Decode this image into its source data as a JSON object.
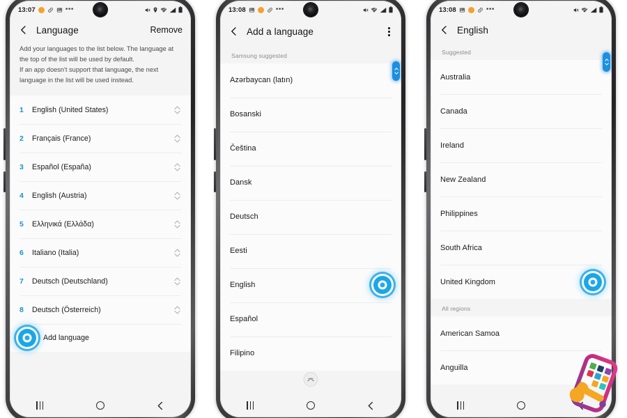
{
  "panels": [
    {
      "id": "language-settings",
      "statusbar": {
        "time": "13:07",
        "left_icons": [
          "badge-icon",
          "link-icon",
          "image-icon",
          "more-icon"
        ],
        "right_icons": [
          "mute-icon",
          "location-icon",
          "wifi-icon",
          "signal-icon",
          "battery-icon"
        ]
      },
      "appbar": {
        "back": "back-icon",
        "title": "Language",
        "action": "Remove"
      },
      "description": [
        "Add your languages to the list below. The language at the top of the list will be used by default.",
        "If an app doesn't support that language, the next language in the list will be used instead."
      ],
      "languages": [
        {
          "num": "1",
          "label": "English (United States)"
        },
        {
          "num": "2",
          "label": "Français (France)"
        },
        {
          "num": "3",
          "label": "Español (España)"
        },
        {
          "num": "4",
          "label": "English (Austria)"
        },
        {
          "num": "5",
          "label": "Ελληνικά (Ελλάδα)"
        },
        {
          "num": "6",
          "label": "Italiano (Italia)"
        },
        {
          "num": "7",
          "label": "Deutsch (Deutschland)"
        },
        {
          "num": "8",
          "label": "Deutsch (Österreich)"
        }
      ],
      "add_language": "Add language",
      "navbar": [
        "recents-icon",
        "home-icon",
        "back-icon"
      ]
    },
    {
      "id": "add-a-language",
      "statusbar": {
        "time": "13:08",
        "left_icons": [
          "image-icon",
          "badge-icon",
          "link-icon",
          "more-icon"
        ],
        "right_icons": [
          "mute-icon",
          "wifi-icon",
          "signal-icon",
          "battery-icon"
        ]
      },
      "appbar": {
        "back": "back-icon",
        "title": "Add a language",
        "action": "kebab-menu-icon"
      },
      "section_header": "Samsung suggested",
      "items": [
        {
          "label": "Azərbaycan (latın)",
          "selected": false
        },
        {
          "label": "Bosanski",
          "selected": false
        },
        {
          "label": "Čeština",
          "selected": false
        },
        {
          "label": "Dansk",
          "selected": false
        },
        {
          "label": "Deutsch",
          "selected": false
        },
        {
          "label": "Eesti",
          "selected": false
        },
        {
          "label": "English",
          "selected": true
        },
        {
          "label": "Español",
          "selected": false
        },
        {
          "label": "Filipino",
          "selected": false
        }
      ],
      "collapse_button": "collapse-up-icon",
      "navbar": [
        "recents-icon",
        "home-icon",
        "back-icon"
      ]
    },
    {
      "id": "english-regions",
      "statusbar": {
        "time": "13:08",
        "left_icons": [
          "image-icon",
          "badge-icon",
          "link-icon",
          "more-icon"
        ],
        "right_icons": [
          "mute-icon",
          "wifi-icon",
          "signal-icon",
          "battery-icon"
        ]
      },
      "appbar": {
        "back": "back-icon",
        "title": "English",
        "action": ""
      },
      "section_header": "Suggested",
      "items": [
        {
          "label": "Australia",
          "selected": false
        },
        {
          "label": "Canada",
          "selected": false
        },
        {
          "label": "Ireland",
          "selected": false
        },
        {
          "label": "New Zealand",
          "selected": false
        },
        {
          "label": "Philippines",
          "selected": false
        },
        {
          "label": "South Africa",
          "selected": false
        },
        {
          "label": "United Kingdom",
          "selected": true
        }
      ],
      "section_header_2": "All regions",
      "items_2": [
        {
          "label": "American Samoa",
          "selected": false
        },
        {
          "label": "Anguilla",
          "selected": false
        }
      ],
      "navbar": [
        "recents-icon",
        "home-icon",
        "back-icon"
      ]
    }
  ],
  "watermark": {
    "name": "phone-repair-logo"
  },
  "colors": {
    "accent_blue": "#1a8fd0",
    "tap_blue": "#2aa9e6",
    "scroll_pill": "#1b8fe0",
    "screen_bg": "#f4f4f4",
    "card_bg": "#fbfbfb",
    "text_primary": "#191919",
    "text_secondary": "#8d8d8d"
  }
}
